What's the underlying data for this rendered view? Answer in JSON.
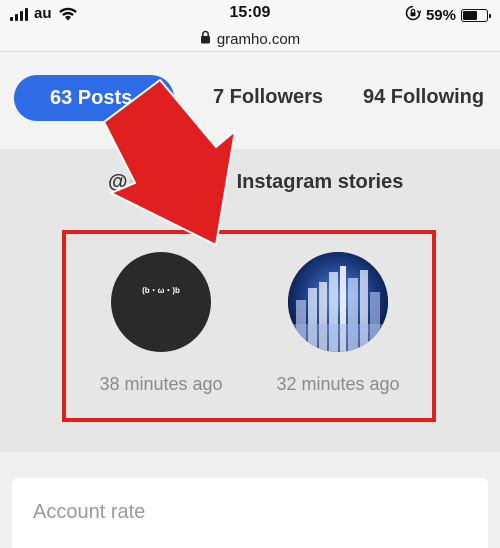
{
  "status_bar": {
    "carrier": "au",
    "time": "15:09",
    "battery_percent": "59%",
    "battery_level": 0.59,
    "icons": [
      "signal-icon",
      "wifi-icon",
      "orientation-lock-icon",
      "battery-icon"
    ]
  },
  "browser": {
    "url": "gramho.com",
    "lock_icon": "lock-icon"
  },
  "profile_counts": {
    "posts": "63 Posts",
    "followers": "7 Followers",
    "following": "94 Following",
    "accent_color": "#2e6be6"
  },
  "stories": {
    "at_sign": "@",
    "title": "Instagram stories",
    "items": [
      {
        "avatar_text": "(b・ω・)b",
        "time": "38 minutes ago"
      },
      {
        "avatar_text": "",
        "time": "32 minutes ago"
      }
    ]
  },
  "account": {
    "label": "Account rate"
  },
  "annotation": {
    "highlight_color": "#e02020"
  }
}
